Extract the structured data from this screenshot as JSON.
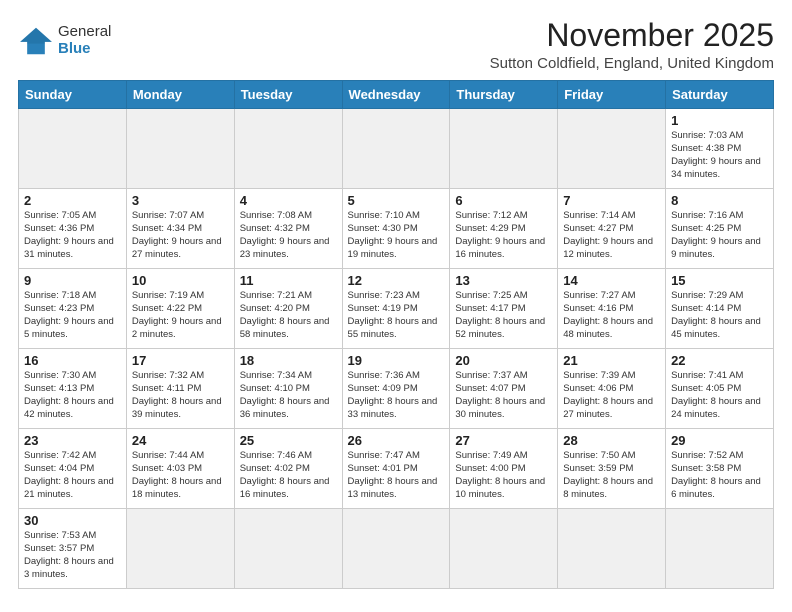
{
  "logo": {
    "general": "General",
    "blue": "Blue"
  },
  "header": {
    "title": "November 2025",
    "subtitle": "Sutton Coldfield, England, United Kingdom"
  },
  "weekdays": [
    "Sunday",
    "Monday",
    "Tuesday",
    "Wednesday",
    "Thursday",
    "Friday",
    "Saturday"
  ],
  "weeks": [
    [
      {
        "day": "",
        "info": ""
      },
      {
        "day": "",
        "info": ""
      },
      {
        "day": "",
        "info": ""
      },
      {
        "day": "",
        "info": ""
      },
      {
        "day": "",
        "info": ""
      },
      {
        "day": "",
        "info": ""
      },
      {
        "day": "1",
        "info": "Sunrise: 7:03 AM\nSunset: 4:38 PM\nDaylight: 9 hours\nand 34 minutes."
      }
    ],
    [
      {
        "day": "2",
        "info": "Sunrise: 7:05 AM\nSunset: 4:36 PM\nDaylight: 9 hours\nand 31 minutes."
      },
      {
        "day": "3",
        "info": "Sunrise: 7:07 AM\nSunset: 4:34 PM\nDaylight: 9 hours\nand 27 minutes."
      },
      {
        "day": "4",
        "info": "Sunrise: 7:08 AM\nSunset: 4:32 PM\nDaylight: 9 hours\nand 23 minutes."
      },
      {
        "day": "5",
        "info": "Sunrise: 7:10 AM\nSunset: 4:30 PM\nDaylight: 9 hours\nand 19 minutes."
      },
      {
        "day": "6",
        "info": "Sunrise: 7:12 AM\nSunset: 4:29 PM\nDaylight: 9 hours\nand 16 minutes."
      },
      {
        "day": "7",
        "info": "Sunrise: 7:14 AM\nSunset: 4:27 PM\nDaylight: 9 hours\nand 12 minutes."
      },
      {
        "day": "8",
        "info": "Sunrise: 7:16 AM\nSunset: 4:25 PM\nDaylight: 9 hours\nand 9 minutes."
      }
    ],
    [
      {
        "day": "9",
        "info": "Sunrise: 7:18 AM\nSunset: 4:23 PM\nDaylight: 9 hours\nand 5 minutes."
      },
      {
        "day": "10",
        "info": "Sunrise: 7:19 AM\nSunset: 4:22 PM\nDaylight: 9 hours\nand 2 minutes."
      },
      {
        "day": "11",
        "info": "Sunrise: 7:21 AM\nSunset: 4:20 PM\nDaylight: 8 hours\nand 58 minutes."
      },
      {
        "day": "12",
        "info": "Sunrise: 7:23 AM\nSunset: 4:19 PM\nDaylight: 8 hours\nand 55 minutes."
      },
      {
        "day": "13",
        "info": "Sunrise: 7:25 AM\nSunset: 4:17 PM\nDaylight: 8 hours\nand 52 minutes."
      },
      {
        "day": "14",
        "info": "Sunrise: 7:27 AM\nSunset: 4:16 PM\nDaylight: 8 hours\nand 48 minutes."
      },
      {
        "day": "15",
        "info": "Sunrise: 7:29 AM\nSunset: 4:14 PM\nDaylight: 8 hours\nand 45 minutes."
      }
    ],
    [
      {
        "day": "16",
        "info": "Sunrise: 7:30 AM\nSunset: 4:13 PM\nDaylight: 8 hours\nand 42 minutes."
      },
      {
        "day": "17",
        "info": "Sunrise: 7:32 AM\nSunset: 4:11 PM\nDaylight: 8 hours\nand 39 minutes."
      },
      {
        "day": "18",
        "info": "Sunrise: 7:34 AM\nSunset: 4:10 PM\nDaylight: 8 hours\nand 36 minutes."
      },
      {
        "day": "19",
        "info": "Sunrise: 7:36 AM\nSunset: 4:09 PM\nDaylight: 8 hours\nand 33 minutes."
      },
      {
        "day": "20",
        "info": "Sunrise: 7:37 AM\nSunset: 4:07 PM\nDaylight: 8 hours\nand 30 minutes."
      },
      {
        "day": "21",
        "info": "Sunrise: 7:39 AM\nSunset: 4:06 PM\nDaylight: 8 hours\nand 27 minutes."
      },
      {
        "day": "22",
        "info": "Sunrise: 7:41 AM\nSunset: 4:05 PM\nDaylight: 8 hours\nand 24 minutes."
      }
    ],
    [
      {
        "day": "23",
        "info": "Sunrise: 7:42 AM\nSunset: 4:04 PM\nDaylight: 8 hours\nand 21 minutes."
      },
      {
        "day": "24",
        "info": "Sunrise: 7:44 AM\nSunset: 4:03 PM\nDaylight: 8 hours\nand 18 minutes."
      },
      {
        "day": "25",
        "info": "Sunrise: 7:46 AM\nSunset: 4:02 PM\nDaylight: 8 hours\nand 16 minutes."
      },
      {
        "day": "26",
        "info": "Sunrise: 7:47 AM\nSunset: 4:01 PM\nDaylight: 8 hours\nand 13 minutes."
      },
      {
        "day": "27",
        "info": "Sunrise: 7:49 AM\nSunset: 4:00 PM\nDaylight: 8 hours\nand 10 minutes."
      },
      {
        "day": "28",
        "info": "Sunrise: 7:50 AM\nSunset: 3:59 PM\nDaylight: 8 hours\nand 8 minutes."
      },
      {
        "day": "29",
        "info": "Sunrise: 7:52 AM\nSunset: 3:58 PM\nDaylight: 8 hours\nand 6 minutes."
      }
    ],
    [
      {
        "day": "30",
        "info": "Sunrise: 7:53 AM\nSunset: 3:57 PM\nDaylight: 8 hours\nand 3 minutes."
      },
      {
        "day": "",
        "info": ""
      },
      {
        "day": "",
        "info": ""
      },
      {
        "day": "",
        "info": ""
      },
      {
        "day": "",
        "info": ""
      },
      {
        "day": "",
        "info": ""
      },
      {
        "day": "",
        "info": ""
      }
    ]
  ]
}
